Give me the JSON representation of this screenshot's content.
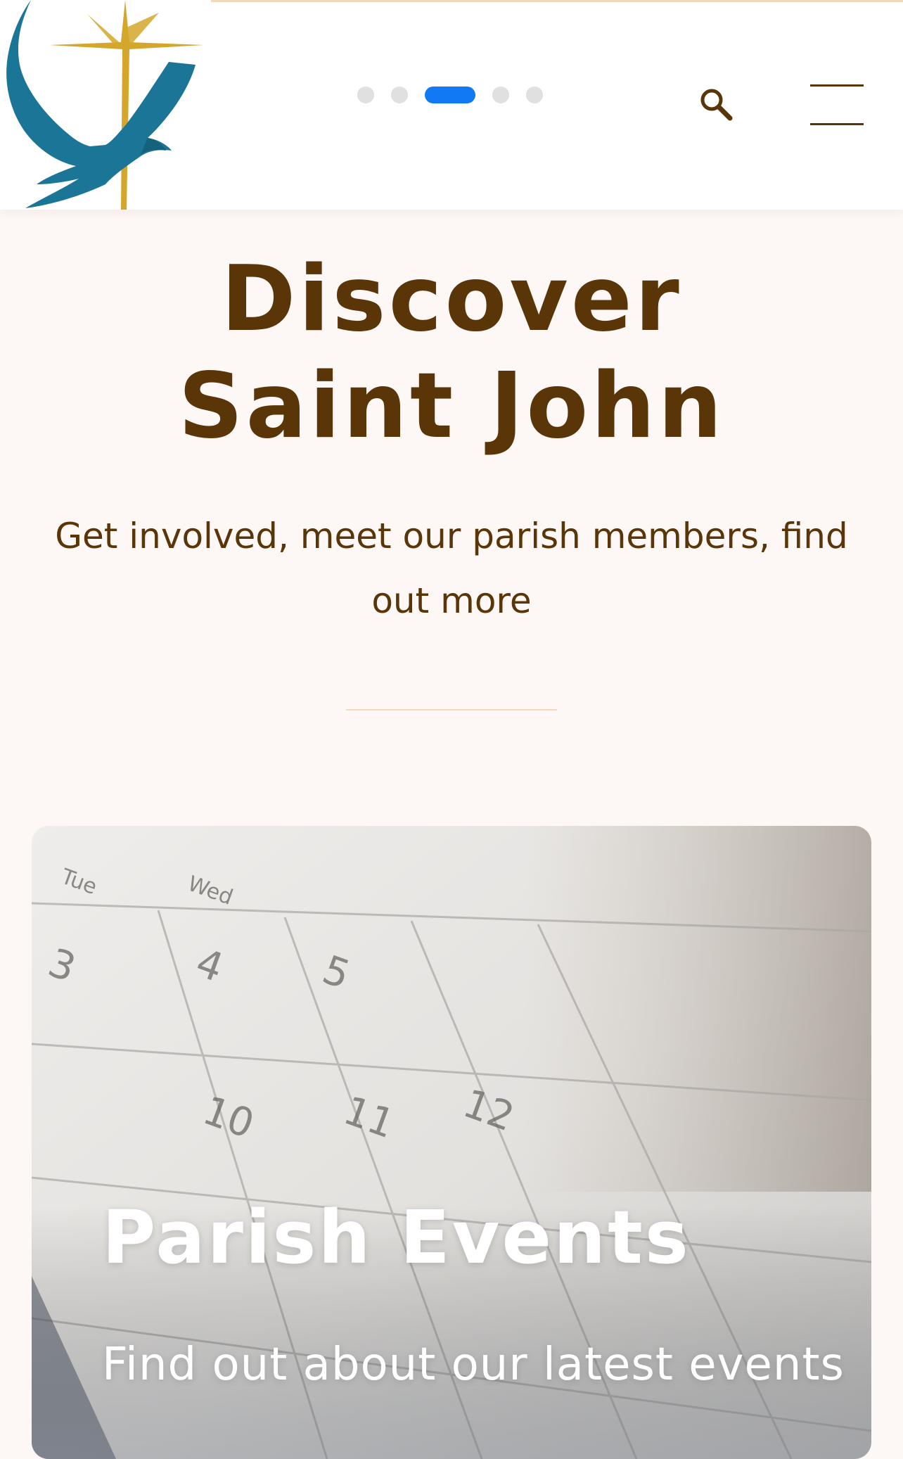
{
  "header": {
    "logo_icon": "dove-with-star-logo-icon",
    "slider": {
      "slide_count": 5,
      "active_index": 2
    },
    "search_icon": "search-icon",
    "menu_icon": "hamburger-menu-icon"
  },
  "hero": {
    "title": "Discover Saint John",
    "subtitle": "Get involved, meet our parish members, find out more"
  },
  "card": {
    "image": "calendar-photo",
    "title": "Parish Events",
    "subtitle": "Find out about our latest events"
  },
  "colors": {
    "brand_brown": "#5a3508",
    "accent_blue": "#1279f5",
    "logo_teal": "#1b7596",
    "logo_gold": "#d4a72c",
    "page_bg": "#fdf8f6"
  }
}
